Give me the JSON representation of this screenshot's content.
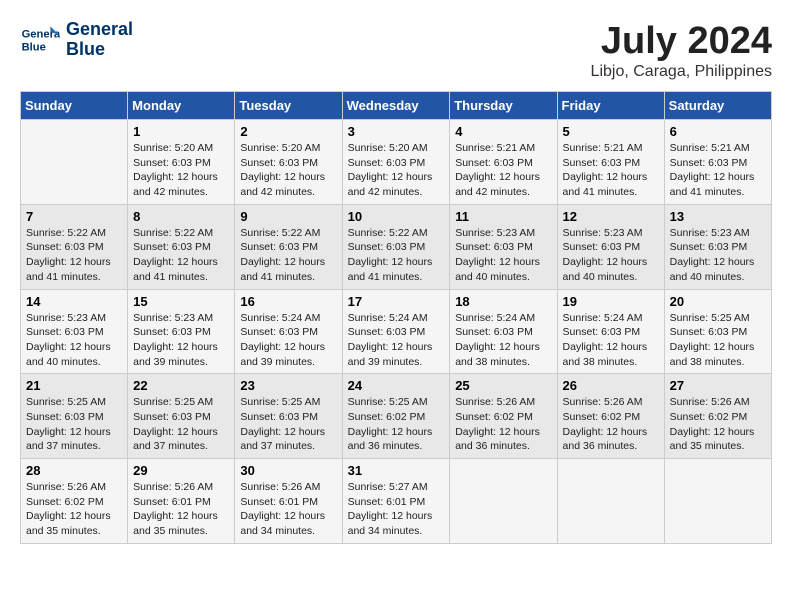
{
  "header": {
    "logo_line1": "General",
    "logo_line2": "Blue",
    "month_title": "July 2024",
    "location": "Libjo, Caraga, Philippines"
  },
  "days_of_week": [
    "Sunday",
    "Monday",
    "Tuesday",
    "Wednesday",
    "Thursday",
    "Friday",
    "Saturday"
  ],
  "weeks": [
    [
      {
        "day": "",
        "info": ""
      },
      {
        "day": "1",
        "info": "Sunrise: 5:20 AM\nSunset: 6:03 PM\nDaylight: 12 hours\nand 42 minutes."
      },
      {
        "day": "2",
        "info": "Sunrise: 5:20 AM\nSunset: 6:03 PM\nDaylight: 12 hours\nand 42 minutes."
      },
      {
        "day": "3",
        "info": "Sunrise: 5:20 AM\nSunset: 6:03 PM\nDaylight: 12 hours\nand 42 minutes."
      },
      {
        "day": "4",
        "info": "Sunrise: 5:21 AM\nSunset: 6:03 PM\nDaylight: 12 hours\nand 42 minutes."
      },
      {
        "day": "5",
        "info": "Sunrise: 5:21 AM\nSunset: 6:03 PM\nDaylight: 12 hours\nand 41 minutes."
      },
      {
        "day": "6",
        "info": "Sunrise: 5:21 AM\nSunset: 6:03 PM\nDaylight: 12 hours\nand 41 minutes."
      }
    ],
    [
      {
        "day": "7",
        "info": "Sunrise: 5:22 AM\nSunset: 6:03 PM\nDaylight: 12 hours\nand 41 minutes."
      },
      {
        "day": "8",
        "info": "Sunrise: 5:22 AM\nSunset: 6:03 PM\nDaylight: 12 hours\nand 41 minutes."
      },
      {
        "day": "9",
        "info": "Sunrise: 5:22 AM\nSunset: 6:03 PM\nDaylight: 12 hours\nand 41 minutes."
      },
      {
        "day": "10",
        "info": "Sunrise: 5:22 AM\nSunset: 6:03 PM\nDaylight: 12 hours\nand 41 minutes."
      },
      {
        "day": "11",
        "info": "Sunrise: 5:23 AM\nSunset: 6:03 PM\nDaylight: 12 hours\nand 40 minutes."
      },
      {
        "day": "12",
        "info": "Sunrise: 5:23 AM\nSunset: 6:03 PM\nDaylight: 12 hours\nand 40 minutes."
      },
      {
        "day": "13",
        "info": "Sunrise: 5:23 AM\nSunset: 6:03 PM\nDaylight: 12 hours\nand 40 minutes."
      }
    ],
    [
      {
        "day": "14",
        "info": "Sunrise: 5:23 AM\nSunset: 6:03 PM\nDaylight: 12 hours\nand 40 minutes."
      },
      {
        "day": "15",
        "info": "Sunrise: 5:23 AM\nSunset: 6:03 PM\nDaylight: 12 hours\nand 39 minutes."
      },
      {
        "day": "16",
        "info": "Sunrise: 5:24 AM\nSunset: 6:03 PM\nDaylight: 12 hours\nand 39 minutes."
      },
      {
        "day": "17",
        "info": "Sunrise: 5:24 AM\nSunset: 6:03 PM\nDaylight: 12 hours\nand 39 minutes."
      },
      {
        "day": "18",
        "info": "Sunrise: 5:24 AM\nSunset: 6:03 PM\nDaylight: 12 hours\nand 38 minutes."
      },
      {
        "day": "19",
        "info": "Sunrise: 5:24 AM\nSunset: 6:03 PM\nDaylight: 12 hours\nand 38 minutes."
      },
      {
        "day": "20",
        "info": "Sunrise: 5:25 AM\nSunset: 6:03 PM\nDaylight: 12 hours\nand 38 minutes."
      }
    ],
    [
      {
        "day": "21",
        "info": "Sunrise: 5:25 AM\nSunset: 6:03 PM\nDaylight: 12 hours\nand 37 minutes."
      },
      {
        "day": "22",
        "info": "Sunrise: 5:25 AM\nSunset: 6:03 PM\nDaylight: 12 hours\nand 37 minutes."
      },
      {
        "day": "23",
        "info": "Sunrise: 5:25 AM\nSunset: 6:03 PM\nDaylight: 12 hours\nand 37 minutes."
      },
      {
        "day": "24",
        "info": "Sunrise: 5:25 AM\nSunset: 6:02 PM\nDaylight: 12 hours\nand 36 minutes."
      },
      {
        "day": "25",
        "info": "Sunrise: 5:26 AM\nSunset: 6:02 PM\nDaylight: 12 hours\nand 36 minutes."
      },
      {
        "day": "26",
        "info": "Sunrise: 5:26 AM\nSunset: 6:02 PM\nDaylight: 12 hours\nand 36 minutes."
      },
      {
        "day": "27",
        "info": "Sunrise: 5:26 AM\nSunset: 6:02 PM\nDaylight: 12 hours\nand 35 minutes."
      }
    ],
    [
      {
        "day": "28",
        "info": "Sunrise: 5:26 AM\nSunset: 6:02 PM\nDaylight: 12 hours\nand 35 minutes."
      },
      {
        "day": "29",
        "info": "Sunrise: 5:26 AM\nSunset: 6:01 PM\nDaylight: 12 hours\nand 35 minutes."
      },
      {
        "day": "30",
        "info": "Sunrise: 5:26 AM\nSunset: 6:01 PM\nDaylight: 12 hours\nand 34 minutes."
      },
      {
        "day": "31",
        "info": "Sunrise: 5:27 AM\nSunset: 6:01 PM\nDaylight: 12 hours\nand 34 minutes."
      },
      {
        "day": "",
        "info": ""
      },
      {
        "day": "",
        "info": ""
      },
      {
        "day": "",
        "info": ""
      }
    ]
  ]
}
